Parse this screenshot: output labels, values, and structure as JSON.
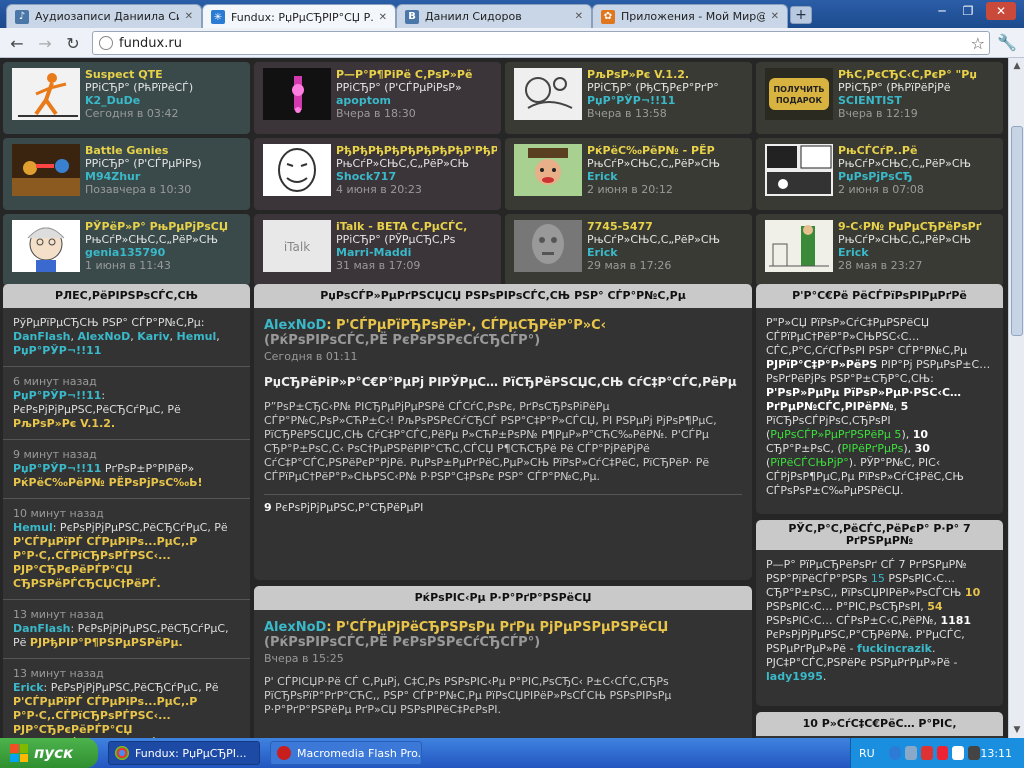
{
  "tabs": [
    {
      "title": "Аудиозаписи Даниила Си...",
      "fav_color": "#4a76a8",
      "fav_glyph": "♪"
    },
    {
      "title": "Fundux: РџРµСЂРІР°СЏ Р...",
      "fav_color": "#2a7bd1",
      "fav_glyph": "✳"
    },
    {
      "title": "Даниил Сидоров",
      "fav_color": "#4a76a8",
      "fav_glyph": "B"
    },
    {
      "title": "Приложения - Мой Мир@...",
      "fav_color": "#e0761e",
      "fav_glyph": "✿"
    }
  ],
  "window_buttons": [
    "─",
    "❐",
    "✕"
  ],
  "address": "fundux.ru",
  "cards": [
    {
      "name": "Suspect QTE",
      "type": "РРіСЂР° (РћРїРёСЃ)",
      "author": "K2_DuDe",
      "time": "Сегодня в 03:42",
      "thumb": "stick"
    },
    {
      "name": "Р—Р°Р¶РіРё С‚РѕР»Рё",
      "type": "РРіСЂР° (Р'СЃРµРіРѕР»",
      "author": "apoptom",
      "time": "Вчера в 18:30",
      "thumb": "pink"
    },
    {
      "name": "РљРѕР»Рє V.1.2.",
      "type": "РРіСЂР° (РђСЂРєР°РґР°",
      "author": "РџР°РЎР¬!!11",
      "time": "Вчера в 13:58",
      "thumb": "sketch"
    },
    {
      "name": "РћС‚РєСЂС‹С‚РєР° \"Рџ",
      "type": "РРіСЂР° (РћРїРёРјРё",
      "author": "SCIENTIST",
      "time": "Вчера в 12:19",
      "thumb": "gift"
    },
    {
      "name": "Battle Genies",
      "type": "РРіСЂР° (Р'СЃРµРіРѕ)",
      "author": "M94Zhur",
      "time": "Позавчера в 10:30",
      "thumb": "battle"
    },
    {
      "name": "РђРђРђРђРђРђРђРђР'РђР",
      "type": "РњСѓР»СЊС‚С„РёР»СЊ",
      "author": "Shock717",
      "time": "4 июня в 20:23",
      "thumb": "face"
    },
    {
      "name": "РќРёС‰РёР№ - РЁР",
      "type": "РњСѓР»СЊС‚С„РёР»СЊ",
      "author": "Erick",
      "time": "2 июня в 20:12",
      "thumb": "beggar"
    },
    {
      "name": "РњСЃСѓР..Рё",
      "type": "РњСѓР»СЊС‚С„РёР»СЊ",
      "author": "РџРѕРјРѕСЂ",
      "time": "2 июня в 07:08",
      "thumb": "comic"
    },
    {
      "name": "РЎРёР»Р° РњРµРјРѕСЏ",
      "type": "РњСѓР»СЊС‚С„РёР»СЊ",
      "author": "genia135790",
      "time": "1 июня в 11:43",
      "thumb": "oldman"
    },
    {
      "name": "iTalk - BETA С‚РµСЃС‚",
      "type": "РРіСЂР° (РЎРµСЂС‚Рѕ",
      "author": "Marri-Maddi",
      "time": "31 мая в 17:09",
      "thumb": "italk"
    },
    {
      "name": "7745-5477",
      "type": "РњСѓР»СЊС‚С„РёР»СЊ",
      "author": "Erick",
      "time": "29 мая в 17:26",
      "thumb": "noise"
    },
    {
      "name": "9-С‹Р№ РџРµСЂРёРѕРґ",
      "type": "РњСѓР»СЊС‚С„РёР»СЊ",
      "author": "Erick",
      "time": "28 мая в 23:27",
      "thumb": "drawing"
    }
  ],
  "left": {
    "heading": "РЛЕС‚РёРІРЅРѕСЃС‚СЊ",
    "intro_text": "РўРµРїРµСЂСЊ РЅР° СЃР°Р№С‚Рµ:",
    "intro_users": [
      "DanFlash",
      "AlexNoD",
      "Kariv",
      "Hemul",
      "РџР°РЎР¬!!11"
    ],
    "feed": [
      {
        "ago": "6 минут назад",
        "nick": "РџР°РЎР¬!!11",
        "text": ": РєРѕРјРјРµРЅС‚РёСЂСѓРµС‚ Рё",
        "item": "РљРѕР»Рє V.1.2."
      },
      {
        "ago": "9 минут назад",
        "nick": "РџР°РЎР¬!!11",
        "text": " РґРѕР±Р°РІРёР»",
        "item": "РќРёС‰РёР№ РЁРѕРјРѕС‰Ь!"
      },
      {
        "ago": "10 минут назад",
        "nick": "Hemul",
        "text": ": РєРѕРјРјРµРЅС‚РёСЂСѓРµС‚ Рё",
        "item": "Р'СЃРµРїРЃ СЃРµРіРѕ...РµС‚.Р Р°Р·С‚.СЃРїСЂРѕРЃРЅС‹... РЈР°СЂРєРёРЃР°СЏ СЂРЅРёРЃСЂСЏС†РёРЃ."
      },
      {
        "ago": "13 минут назад",
        "nick": "DanFlash",
        "text": ": РєРѕРјРјРµРЅС‚РёСЂСѓРµС‚ Рё",
        "item": "РЈРђРІР°Р¶РЅРµРЅРёРµ."
      },
      {
        "ago": "13 минут назад",
        "nick": "Erick",
        "text": ": РєРѕРјРјРµРЅС‚РёСЂСѓРµС‚ Рё",
        "item": "Р'СЃРµРїРЃ СЃРµРіРѕ...РµС‚.Р Р°Р·С‚.СЃРїСЂРѕРЃРЅС‹... РЈР°СЂРєРёРЃР°СЏ СЂРЅРёРЃСЂСЏС†РёРЃ."
      }
    ]
  },
  "center": {
    "heading": "РџРѕСЃР»РµРґРЅСЏСЏ РЅРѕРІРѕСЃС‚СЊ РЅР° СЃР°Р№С‚Рµ",
    "post": {
      "author": "AlexNoD",
      "title": ": Р'СЃРµРїРЂРѕРёР·, СЃРµСЂРёР°Р»С‹",
      "subtitle": "(РќРѕРІРѕСЃС‚РЁ РєРѕРЅРєСѓСЂСЃР°)",
      "date": "Сегодня в 01:11",
      "lead": "РџСЂРёРіР»Р°С€Р°РµРј РІРЎРµС… РїСЂРёРЅСЏС‚СЊ СѓС‡Р°СЃС‚РёРµ",
      "body": "Р”РѕР±СЂС‹Р№ РІСЂРµРјРµРЅРё СЃСѓС‚РѕРє, РґРѕСЂРѕРіРёРµ СЃР°Р№С‚РѕР»СЋР±С‹! РљРѕРЅРєСѓСЂСЃ РЅР°С‡Р°Р»СЃСЏ, РІ РЅРµРј РјРѕР¶РµС‚ РїСЂРёРЅСЏС‚СЊ СѓС‡Р°СЃС‚РёРµ Р»СЋР±РѕР№ Р¶РµР»Р°СЋС‰РёР№. Р'СЃРµ СЂР°Р±РѕС‚С‹ РѕС†РµРЅРёРІР°СЋС‚СЃСЏ Р¶СЋСЂРё Рё СЃР°РјРёРјРё СѓС‡Р°СЃС‚РЅРёРєР°РјРё. РџРѕР±РµРґРёС‚РµР»СЊ РїРѕР»СѓС‡РёС‚ РїСЂРёР· Рё СЃРїРµС†РёР°Р»СЊРЅС‹Р№ Р·РЅР°С‡РѕРє РЅР° СЃР°Р№С‚Рµ.",
      "comments_count": "9",
      "comments_label": "РєРѕРјРјРµРЅС‚Р°СЂРёРµРІ"
    },
    "heading2": "РќРѕРІС‹Рµ Р·Р°РґР°РЅРёСЏ",
    "post2": {
      "author": "AlexNoD",
      "title": ": Р'СЃРµРјРёСЂРЅРѕРµ РґРµ РјРµРЅРµРЅРёСЏ",
      "subtitle": "(РќРѕРІРѕСЃС‚РЁ РєРѕРЅРєСѓСЂСЃР°)",
      "date": "Вчера в 15:25",
      "body": "Р' СЃРІСЏР·Рё СЃ С‚РµРј, С‡С‚Рѕ РЅРѕРІС‹Рµ Р°РІС‚РѕСЂС‹ Р±С‹СЃС‚СЂРѕ РїСЂРѕРїР°РґР°СЋС‚, РЅР° СЃР°Р№С‚Рµ РїРѕСЏРІРёР»РѕСЃСЊ РЅРѕРІРѕРµ Р·Р°РґР°РЅРёРµ РґР»СЏ РЅРѕРІРёС‡РєРѕРІ."
    }
  },
  "right": {
    "heading": "Р'Р°С€Рё РёСЃРїРѕРІРµРґРё",
    "p1_text": "Р\"Р»СЏ РїРѕР»СѓС‡РµРЅРёСЏ СЃРїРµС†РёР°Р»СЊРЅС‹С… СЃС‚Р°С‚СѓСЃРѕРІ РЅР° СЃР°Р№С‚Рµ",
    "p1_bold": "РЈРїР°С‡Р°Р»РёРЅ",
    "p1_rest": "РІР°Рј РЅРµРѕР±С…РѕРґРёРјРѕ РЅР°Р±СЂР°С‚СЊ:",
    "p1_need": "Р'РѕР»РµРµ РїРѕР»РµР·РЅС‹С… РґРµР№СЃС‚РІРёР№",
    "p1_5": "5",
    "p1_5u": "РїСЂРѕСЃРјРѕС‚СЂРѕРІ",
    "p1_g1": "РџРѕСЃР»РµРґРЅРёРµ 5",
    "p1_10": "10",
    "p1_10u": "СЂР°Р±РѕС‚",
    "p1_g2": "РІРёРґРµРѕ",
    "p1_30": "30",
    "p1_g3": "РїРёСЃСЊРјР°",
    "p1_tail": "РЎР°Р№С‚ РІС‹ СЃРјРѕР¶РµС‚Рµ РїРѕР»СѓС‡РёС‚СЊ СЃРѕРѕР±С‰РµРЅРёСЏ.",
    "heading2": "РЎС‚Р°С‚РёСЃС‚РёРєР° Р·Р° 7 РґРЅРµР№",
    "s_a": "Р—Р° РїРµСЂРёРѕРґ СЃ 7 РґРЅРµР№ РЅР°РїРёСЃР°РЅРѕ",
    "s_15": "15",
    "s_b": "РЅРѕРІС‹С… СЂР°Р±РѕС‚, РїРѕСЏРІРёР»РѕСЃСЊ",
    "s_10": "10",
    "s_c": "РЅРѕРІС‹С… Р°РІС‚РѕСЂРѕРІ,",
    "s_54": "54",
    "s_d": "РЅРѕРІС‹С… СЃРѕР±С‹С‚РёР№,",
    "s_1181": "1181",
    "s_e": "РєРѕРјРјРµРЅС‚Р°СЂРёР№. Р'РµСЃС‚ РЅРµРґРµР»Рё -",
    "s_u1": "fuckincrazik",
    "s_f": ". РЈС‡Р°СЃС‚РЅРёРє РЅРµРґРµР»Рё -",
    "s_u2": "lady1995",
    "heading3": "10 Р»СѓС‡С€РёС… Р°РІС‚"
  },
  "taskbar": {
    "start_label": "пуск",
    "tasks": [
      {
        "label": "Fundux: РџРµСЂРІ...",
        "color": "#3c8d3c"
      },
      {
        "label": "Macromedia Flash Pro...",
        "color": "#d22"
      }
    ],
    "lang": "RU",
    "clock": "13:11"
  }
}
